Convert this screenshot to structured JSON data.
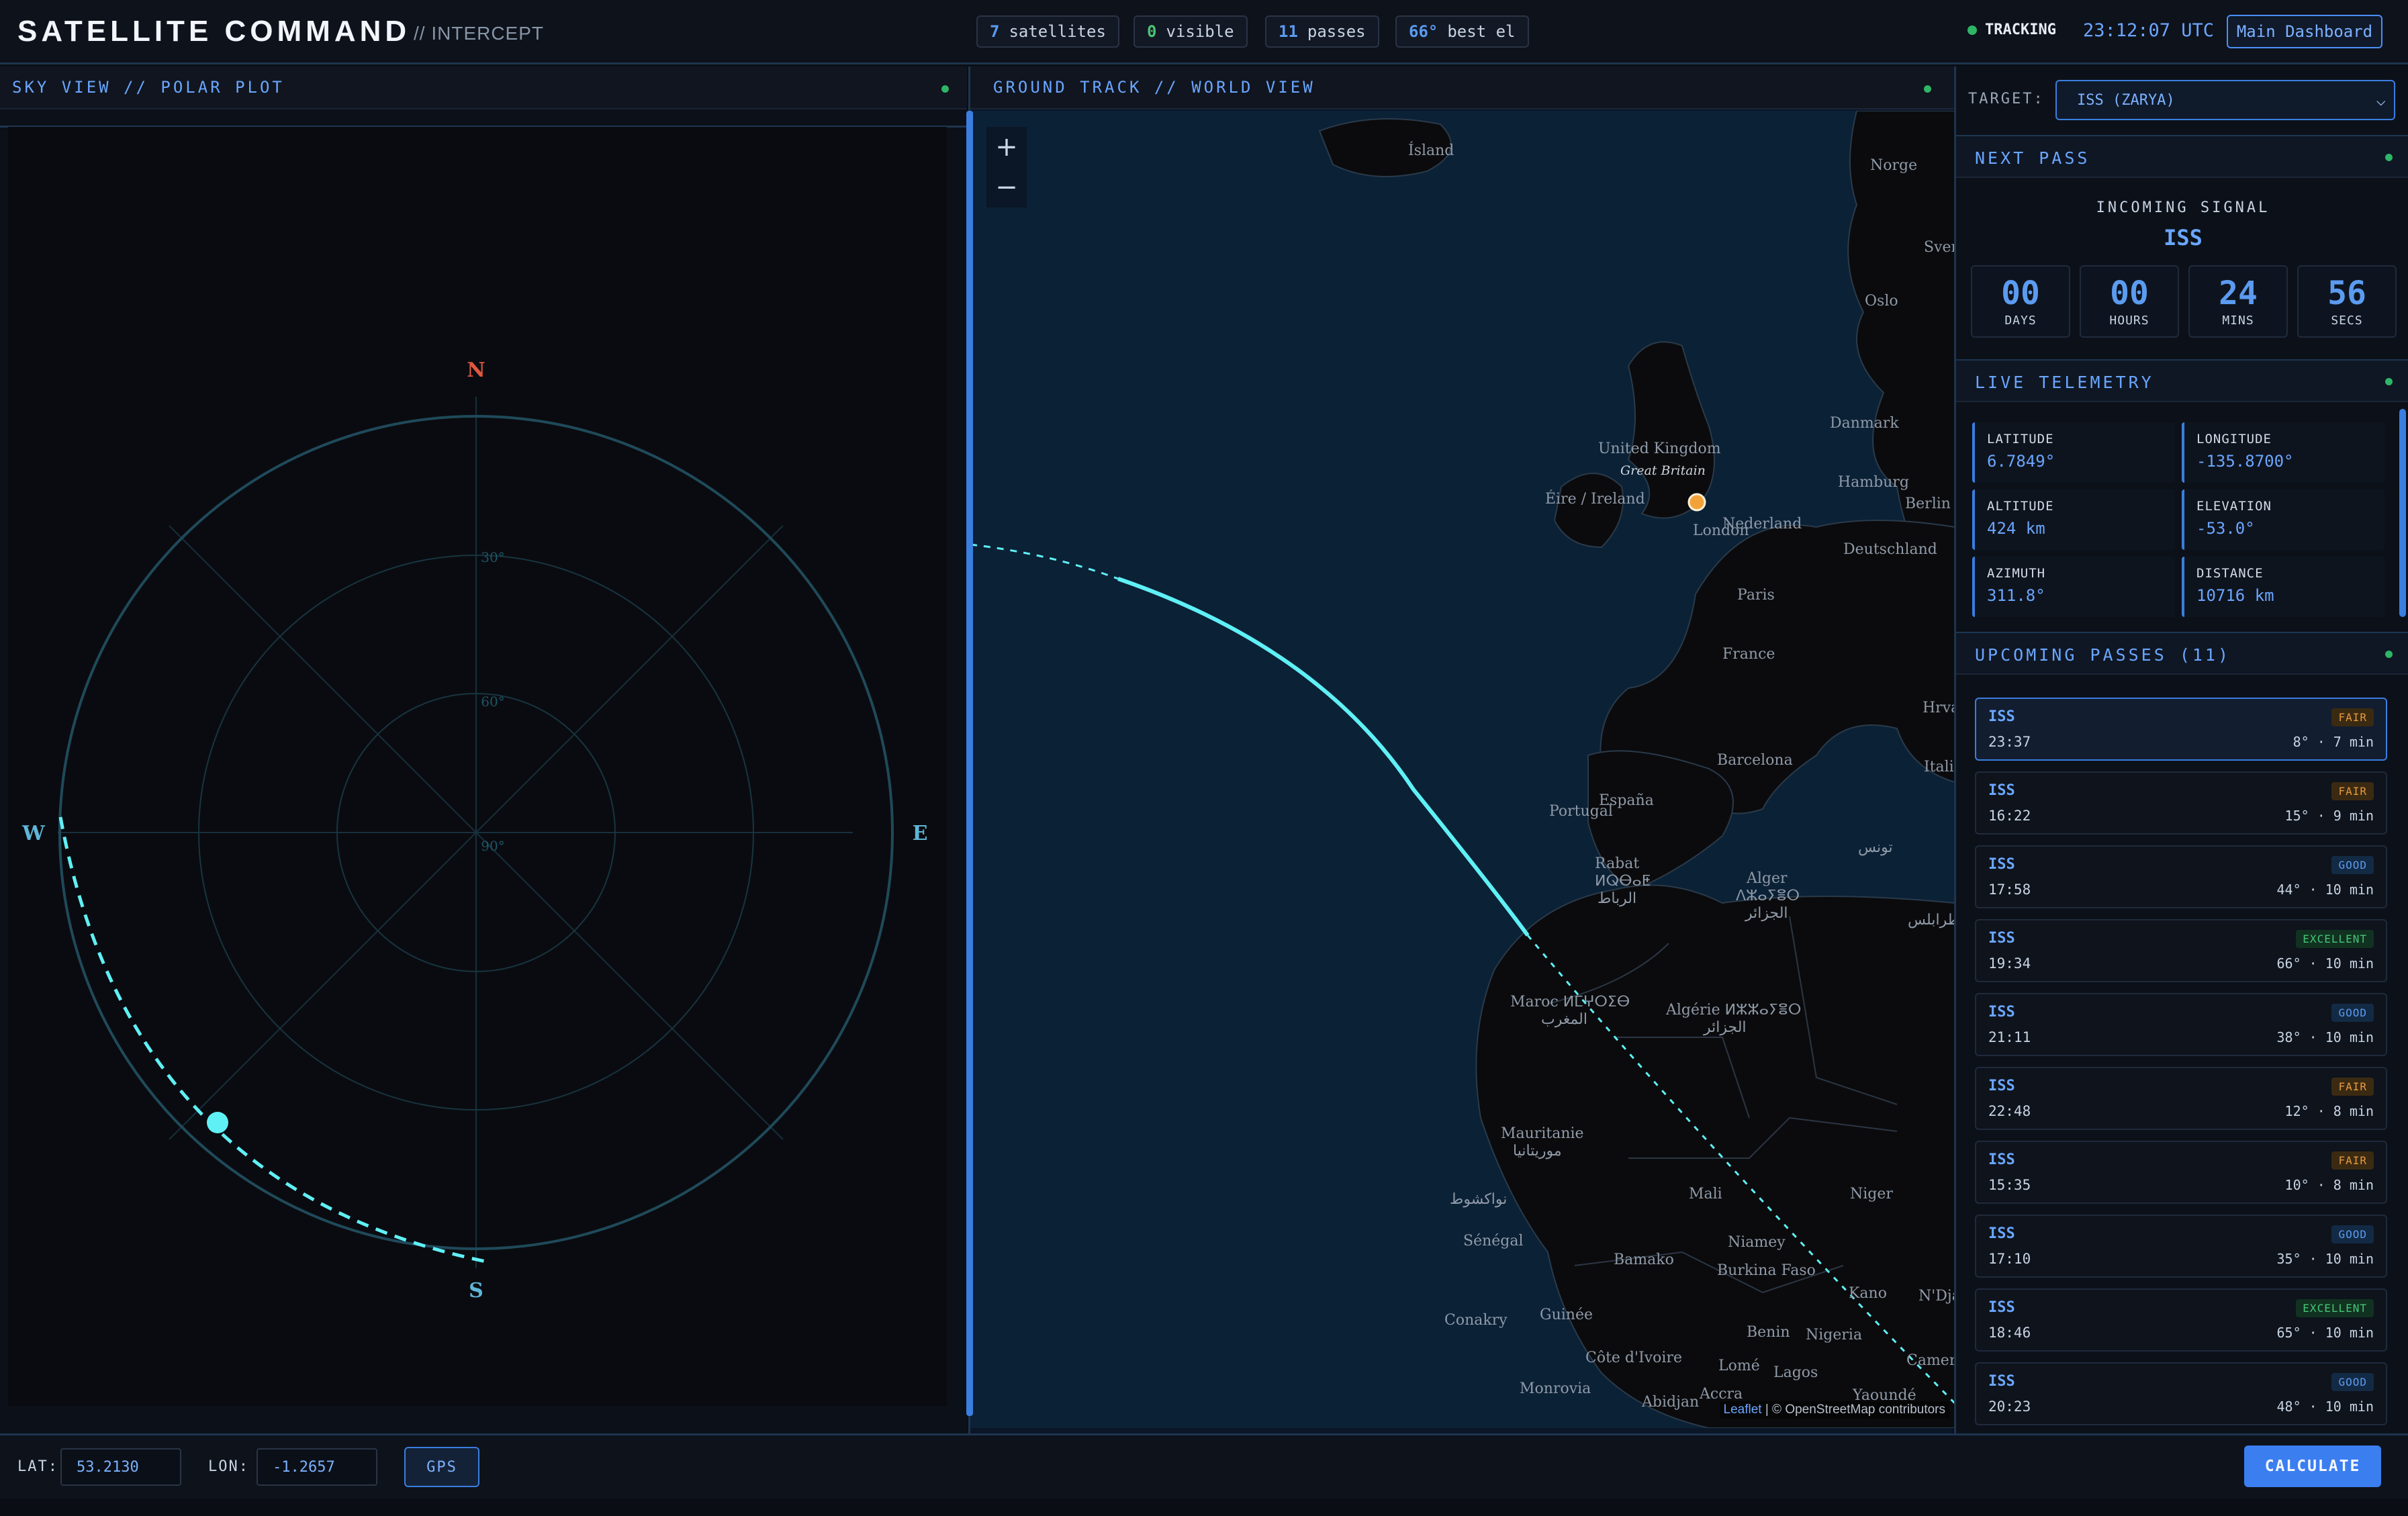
{
  "header": {
    "title": "SATELLITE COMMAND",
    "subtitle": "// INTERCEPT",
    "stats": [
      {
        "value": "7",
        "label": "satellites"
      },
      {
        "value": "0",
        "label": "visible"
      },
      {
        "value": "11",
        "label": "passes"
      },
      {
        "value": "66°",
        "label": "best el"
      }
    ],
    "tracking_label": "TRACKING",
    "clock": "23:12:07 UTC",
    "dashboard_button": "Main Dashboard"
  },
  "sky_view": {
    "title": "SKY VIEW // POLAR PLOT",
    "compass": {
      "n": "N",
      "s": "S",
      "e": "E",
      "w": "W"
    },
    "ring_labels": [
      "30°",
      "60°",
      "90°"
    ],
    "accent_color": "#5ff0f5"
  },
  "ground_track": {
    "title": "GROUND TRACK // WORLD VIEW",
    "zoom_in": "+",
    "zoom_out": "−",
    "attribution_link": "Leaflet",
    "attribution_text": "| © OpenStreetMap contributors",
    "place_labels": [
      "Ísland",
      "Norge",
      "Sverige",
      "Oslo",
      "United Kingdom",
      "Great Britain",
      "Éire / Ireland",
      "London",
      "Nederland",
      "Hamburg",
      "Berlin",
      "Danmark",
      "Deutschland",
      "Paris",
      "France",
      "España",
      "Portugal",
      "Barcelona",
      "Italia",
      "Hrvatska",
      "Rabat",
      "ⵍⵕⴱⴰⵟ",
      "الرباط",
      "Alger",
      "ⴷⵣⴰⵢⴻⵔ",
      "الجزائر",
      "تونس",
      "طرابلس",
      "Maroc ⵍⵎⵖⵔⵉⴱ",
      "المغرب",
      "Algérie ⵍⵣⵣⴰⵢⴻⵔ",
      "الجزائر",
      "Mauritanie",
      "موريتانيا",
      "نواكشوط",
      "Mali",
      "Niger",
      "Sénégal",
      "Bamako",
      "Niamey",
      "Burkina Faso",
      "Kano",
      "N'Djamena",
      "Conakry",
      "Guinée",
      "Côte d'Ivoire",
      "Benin",
      "Nigeria",
      "Lomé",
      "Lagos",
      "Cameroun",
      "Monrovia",
      "Accra",
      "Abidjan",
      "Yaoundé"
    ]
  },
  "sidebar": {
    "target_label": "TARGET:",
    "target_value": "ISS (ZARYA)",
    "next_pass": {
      "title": "NEXT PASS",
      "incoming_label": "INCOMING SIGNAL",
      "satellite": "ISS",
      "countdown": [
        {
          "value": "00",
          "label": "DAYS"
        },
        {
          "value": "00",
          "label": "HOURS"
        },
        {
          "value": "24",
          "label": "MINS"
        },
        {
          "value": "56",
          "label": "SECS"
        }
      ]
    },
    "telemetry": {
      "title": "LIVE TELEMETRY",
      "items": [
        {
          "key": "LATITUDE",
          "value": "6.7849°"
        },
        {
          "key": "LONGITUDE",
          "value": "-135.8700°"
        },
        {
          "key": "ALTITUDE",
          "value": "424 km"
        },
        {
          "key": "ELEVATION",
          "value": "-53.0°"
        },
        {
          "key": "AZIMUTH",
          "value": "311.8°"
        },
        {
          "key": "DISTANCE",
          "value": "10716 km"
        }
      ]
    },
    "passes": {
      "title": "UPCOMING PASSES (11)",
      "items": [
        {
          "name": "ISS",
          "time": "23:37",
          "quality": "FAIR",
          "meta": "8° · 7 min"
        },
        {
          "name": "ISS",
          "time": "16:22",
          "quality": "FAIR",
          "meta": "15° · 9 min"
        },
        {
          "name": "ISS",
          "time": "17:58",
          "quality": "GOOD",
          "meta": "44° · 10 min"
        },
        {
          "name": "ISS",
          "time": "19:34",
          "quality": "EXCELLENT",
          "meta": "66° · 10 min"
        },
        {
          "name": "ISS",
          "time": "21:11",
          "quality": "GOOD",
          "meta": "38° · 10 min"
        },
        {
          "name": "ISS",
          "time": "22:48",
          "quality": "FAIR",
          "meta": "12° · 8 min"
        },
        {
          "name": "ISS",
          "time": "15:35",
          "quality": "FAIR",
          "meta": "10° · 8 min"
        },
        {
          "name": "ISS",
          "time": "17:10",
          "quality": "GOOD",
          "meta": "35° · 10 min"
        },
        {
          "name": "ISS",
          "time": "18:46",
          "quality": "EXCELLENT",
          "meta": "65° · 10 min"
        },
        {
          "name": "ISS",
          "time": "20:23",
          "quality": "GOOD",
          "meta": "48° · 10 min"
        }
      ]
    }
  },
  "footer": {
    "lat_label": "LAT:",
    "lat_value": "53.2130",
    "lon_label": "LON:",
    "lon_value": "-1.2657",
    "gps_button": "GPS",
    "calculate_button": "CALCULATE"
  }
}
